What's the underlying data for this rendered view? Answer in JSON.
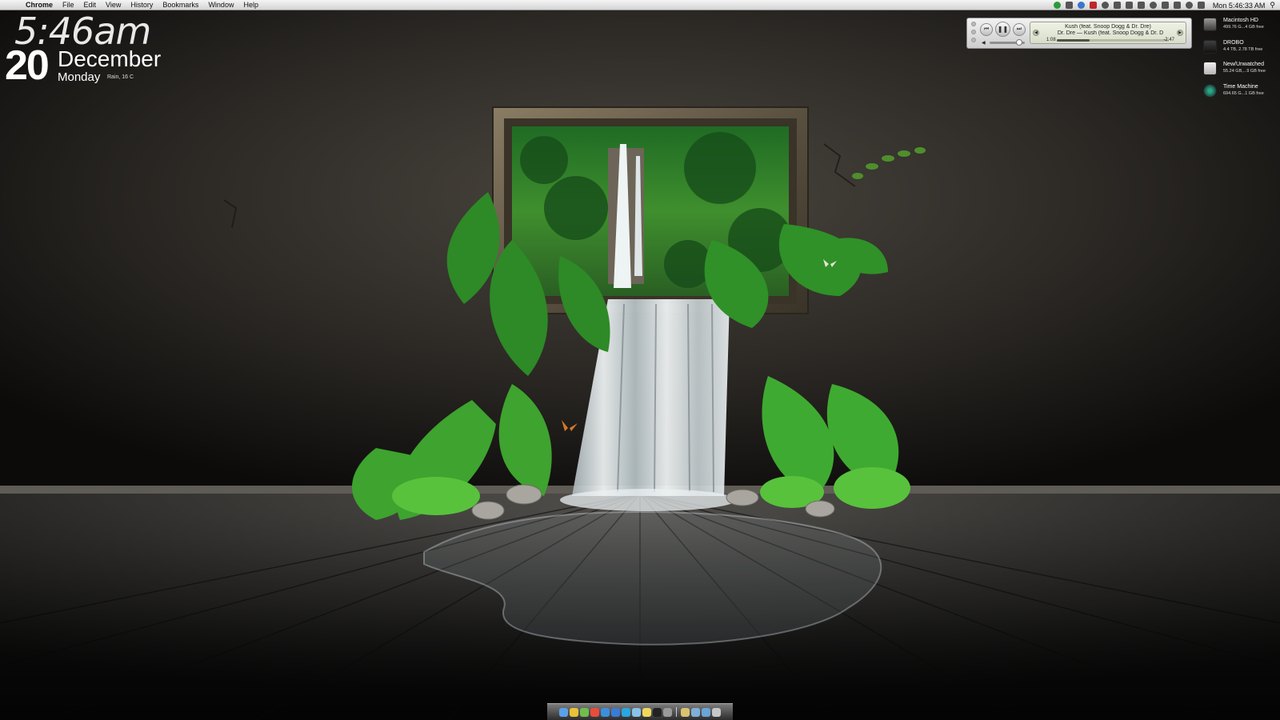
{
  "menubar": {
    "app_name": "Chrome",
    "menus": [
      "File",
      "Edit",
      "View",
      "History",
      "Bookmarks",
      "Window",
      "Help"
    ],
    "clock": "Mon 5:46:33 AM",
    "status_icons": [
      "green-circle-icon",
      "wifi-settings-icon",
      "dropbox-icon",
      "red-app-icon",
      "gear-icon",
      "cloud-icon",
      "person-icon",
      "display-icon",
      "time-machine-icon",
      "bluetooth-icon",
      "battery-icon",
      "wifi-icon",
      "volume-icon"
    ]
  },
  "clock_widget": {
    "time": "5:46am",
    "day": "20",
    "month": "December",
    "weekday": "Monday",
    "weather": "Rain, 16 C"
  },
  "itunes": {
    "track_title": "Kush (feat. Snoop Dogg & Dr. Dre)",
    "track_artist": "Dr. Dre — Kush (feat. Snoop Dogg & Dr. D",
    "elapsed": "1:08",
    "remaining": "-2:47",
    "progress": 0.29,
    "volume": 0.85,
    "buttons": {
      "prev": "⏮",
      "pause": "❚❚",
      "next": "⏭"
    }
  },
  "drives": [
    {
      "name": "Macintosh HD",
      "info": "499.76 G...4 GB free",
      "icon": "hard-drive-icon"
    },
    {
      "name": "DROBO",
      "info": "4.4 TB, 2.78 TB free",
      "icon": "drobo-drive-icon"
    },
    {
      "name": "New/Unwatched",
      "info": "55.24 GB,...9 GB free",
      "icon": "external-drive-icon"
    },
    {
      "name": "Time Machine",
      "info": "694.65 G...1 GB free",
      "icon": "time-machine-drive-icon"
    }
  ],
  "dock": {
    "apps": [
      {
        "name": "finder",
        "color": "#5aa0e8"
      },
      {
        "name": "chrome",
        "color": "#e8c23a"
      },
      {
        "name": "adium",
        "color": "#6fbf4a"
      },
      {
        "name": "ical",
        "color": "#e94b3c"
      },
      {
        "name": "safari",
        "color": "#3d8fdc"
      },
      {
        "name": "itunes",
        "color": "#3a7bd5"
      },
      {
        "name": "skype",
        "color": "#2aa6e0"
      },
      {
        "name": "app-store",
        "color": "#88c4e8"
      },
      {
        "name": "notes",
        "color": "#f1d75a"
      },
      {
        "name": "terminal",
        "color": "#222222"
      },
      {
        "name": "system-preferences",
        "color": "#9a9a9a"
      }
    ],
    "stacks": [
      {
        "name": "applications-stack",
        "color": "#d9c270"
      },
      {
        "name": "documents-stack",
        "color": "#7fb0da"
      },
      {
        "name": "downloads-stack",
        "color": "#6aa5d8"
      },
      {
        "name": "trash",
        "color": "#c8c8c8"
      }
    ]
  },
  "colors": {
    "wall": "#3a3631",
    "floor": "#4a4a48",
    "foliage": "#2f8a2a",
    "water": "#e8eef0"
  }
}
